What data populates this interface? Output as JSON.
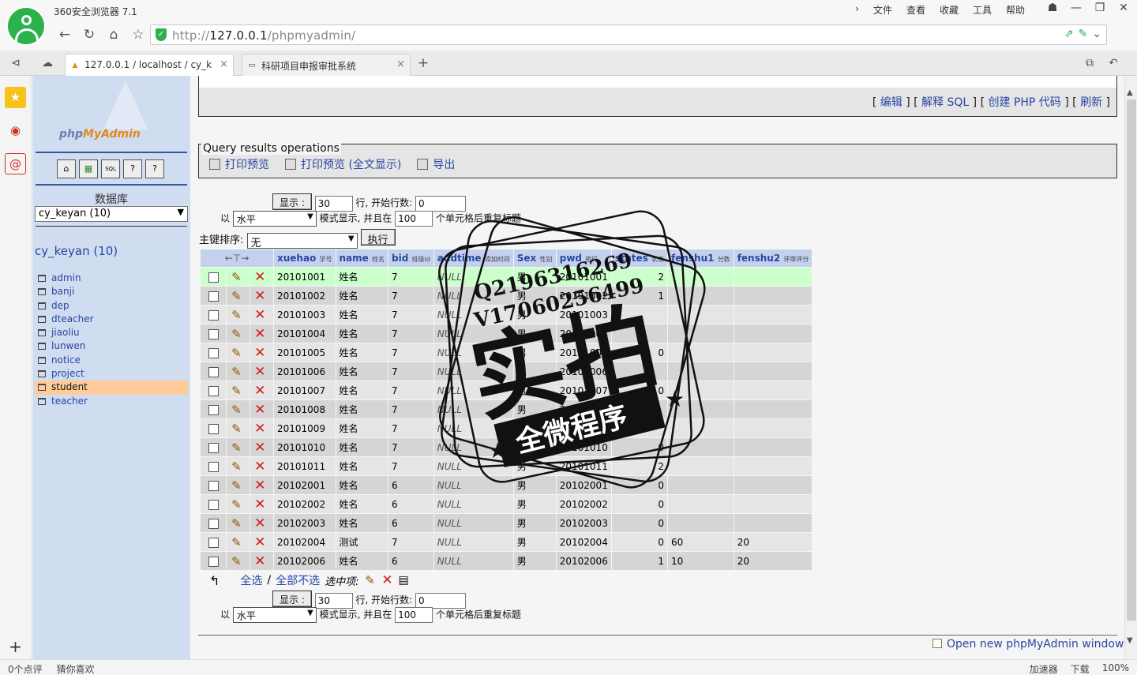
{
  "browser": {
    "name": "360安全浏览器 7.1",
    "menu": [
      "文件",
      "查看",
      "收藏",
      "工具",
      "帮助"
    ],
    "url_scheme": "http://",
    "url_host": "127.0.0.1",
    "url_path": "/phpmyadmin/"
  },
  "tabs": [
    {
      "label": "127.0.0.1 / localhost / cy_k",
      "active": true
    },
    {
      "label": "科研项目申报审批系统",
      "active": false
    }
  ],
  "sidebar": {
    "logo_php": "php",
    "logo_my": "MyAdmin",
    "icon_labels": [
      "⌂",
      "▦",
      "SQL",
      "?",
      "?"
    ],
    "db_label": "数据库",
    "db_select": "cy_keyan (10)",
    "db_title": "cy_keyan (10)",
    "tables": [
      {
        "name": "admin"
      },
      {
        "name": "banji"
      },
      {
        "name": "dep"
      },
      {
        "name": "dteacher"
      },
      {
        "name": "jiaoliu"
      },
      {
        "name": "lunwen"
      },
      {
        "name": "notice"
      },
      {
        "name": "project"
      },
      {
        "name": "student",
        "active": true
      },
      {
        "name": "teacher"
      }
    ]
  },
  "sql_links": {
    "edit": "编辑",
    "explain": "解释 SQL",
    "php": "创建 PHP 代码",
    "refresh": "刷新"
  },
  "ops": {
    "legend": "Query results operations",
    "print": "打印预览",
    "print_full": "打印预览 (全文显示)",
    "export": "导出"
  },
  "nav": {
    "show_btn": "显示 :",
    "rows": "30",
    "rows_label": "行, 开始行数:",
    "start": "0",
    "mode_prefix": "以",
    "mode": "水平",
    "mode_label": "模式显示, 并且在",
    "repeat": "100",
    "repeat_label": "个单元格后重复标题",
    "sort_label": "主键排序:",
    "sort_value": "无",
    "go_btn": "执行"
  },
  "grid": {
    "columns": [
      {
        "name": "xuehao",
        "sub": "学号"
      },
      {
        "name": "name",
        "sub": "姓名"
      },
      {
        "name": "bid",
        "sub": "班级id"
      },
      {
        "name": "addtime",
        "sub": "添加时间"
      },
      {
        "name": "Sex",
        "sub": "性别"
      },
      {
        "name": "pwd",
        "sub": "密码"
      },
      {
        "name": "states",
        "sub": "状态"
      },
      {
        "name": "fenshu1",
        "sub": "分数"
      },
      {
        "name": "fenshu2",
        "sub": "评审评分"
      }
    ],
    "rows": [
      [
        "20101001",
        "姓名",
        "7",
        "NULL",
        "男",
        "20101001",
        "2",
        "",
        ""
      ],
      [
        "20101002",
        "姓名",
        "7",
        "NULL",
        "男",
        "20101002",
        "1",
        "",
        ""
      ],
      [
        "20101003",
        "姓名",
        "7",
        "NULL",
        "男",
        "20101003",
        "",
        "",
        ""
      ],
      [
        "20101004",
        "姓名",
        "7",
        "NULL",
        "男",
        "20101004",
        "",
        "",
        ""
      ],
      [
        "20101005",
        "姓名",
        "7",
        "NULL",
        "男",
        "20101005",
        "0",
        "",
        ""
      ],
      [
        "20101006",
        "姓名",
        "7",
        "NULL",
        "男",
        "20101006",
        "",
        "",
        ""
      ],
      [
        "20101007",
        "姓名",
        "7",
        "NULL",
        "男",
        "20101007",
        "0",
        "",
        ""
      ],
      [
        "20101008",
        "姓名",
        "7",
        "NULL",
        "男",
        "20101008",
        "",
        "",
        ""
      ],
      [
        "20101009",
        "姓名",
        "7",
        "NULL",
        "男",
        "20101009",
        "",
        "",
        ""
      ],
      [
        "20101010",
        "姓名",
        "7",
        "NULL",
        "男",
        "20101010",
        "0",
        "",
        ""
      ],
      [
        "20101011",
        "姓名",
        "7",
        "NULL",
        "男",
        "20101011",
        "2",
        "",
        ""
      ],
      [
        "20102001",
        "姓名",
        "6",
        "NULL",
        "男",
        "20102001",
        "0",
        "",
        ""
      ],
      [
        "20102002",
        "姓名",
        "6",
        "NULL",
        "男",
        "20102002",
        "0",
        "",
        ""
      ],
      [
        "20102003",
        "姓名",
        "6",
        "NULL",
        "男",
        "20102003",
        "0",
        "",
        ""
      ],
      [
        "20102004",
        "测试",
        "7",
        "NULL",
        "男",
        "20102004",
        "0",
        "60",
        "20"
      ],
      [
        "20102006",
        "姓名",
        "6",
        "NULL",
        "男",
        "20102006",
        "1",
        "10",
        "20"
      ]
    ]
  },
  "bulk": {
    "select_all": "全选",
    "sep": "/",
    "deselect_all": "全部不选",
    "with_selected": "选中项:"
  },
  "open_window": "Open new phpMyAdmin window",
  "status": {
    "left": [
      "0个点评",
      "猜你喜欢"
    ],
    "right": [
      "加速器",
      "下载",
      "100%"
    ]
  },
  "watermark": {
    "line1": "Q2196316269",
    "line2": "V17060256499",
    "main": "实拍",
    "banner": "全微程序"
  },
  "colors": {
    "pma_left_bg": "#d0dcf0",
    "link": "#2847a3",
    "header": "#c4d1ec",
    "highlight_row": "#ccffcc",
    "active_table": "#ffcc99",
    "browser_green": "#2bb24c"
  }
}
